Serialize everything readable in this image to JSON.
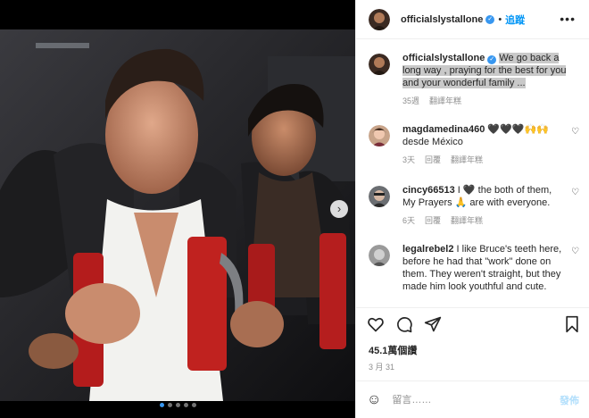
{
  "post": {
    "author": "officialslystallone",
    "follow_label": "追蹤",
    "separator": "•",
    "more_label": "•••",
    "verified_glyph": "✓"
  },
  "photo": {
    "slide_count": 5,
    "active_slide": 1,
    "next_glyph": "›"
  },
  "caption": {
    "username": "officialslystallone",
    "text": "We go back a long way , praying for the best for you and your wonderful family ...",
    "time": "35週",
    "translate": "翻譯年糕"
  },
  "comments": [
    {
      "username": "magdamedina460",
      "text": "🖤🖤🖤🙌🙌 desde México",
      "time": "3天",
      "reply": "回覆",
      "translate": "翻譯年糕"
    },
    {
      "username": "cincy66513",
      "text": "I 🖤 the both of them, My Prayers 🙏 are with everyone.",
      "time": "6天",
      "reply": "回覆",
      "translate": "翻譯年糕"
    },
    {
      "username": "legalrebel2",
      "text": "I like Bruce's teeth here, before he had that \"work\" done on them. They weren't straight, but they made him look youthful and cute.",
      "time": "",
      "reply": "",
      "translate": ""
    }
  ],
  "actions": {
    "icons": [
      "heart-icon",
      "comment-icon",
      "share-icon",
      "bookmark-icon"
    ]
  },
  "stats": {
    "likes": "45.1萬個讚",
    "date": "3 月 31"
  },
  "composer": {
    "emoji_glyph": "☺",
    "placeholder": "留言……",
    "post_label": "發佈"
  },
  "colors": {
    "accent": "#0095f6",
    "verified": "#3897f0",
    "muted": "#8e8e8e",
    "text": "#262626"
  }
}
